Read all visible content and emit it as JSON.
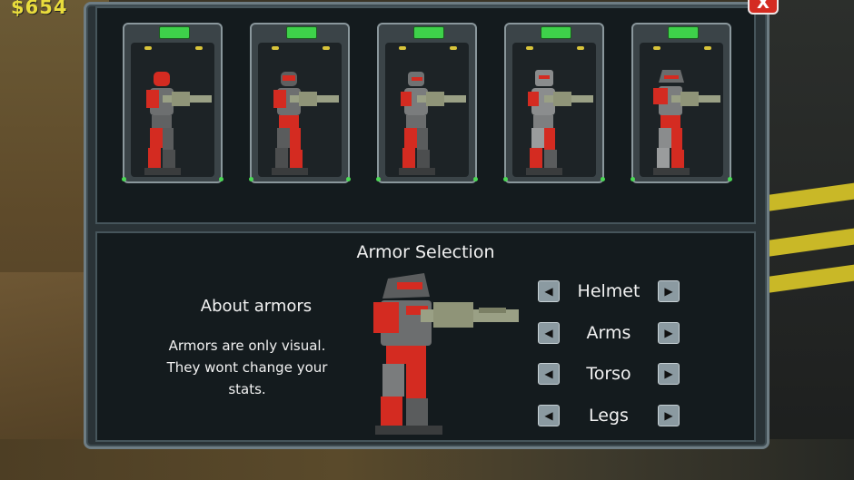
{
  "hud": {
    "money": "$654"
  },
  "dialog": {
    "close_label": "X",
    "cards": [
      {
        "id": "armor-1"
      },
      {
        "id": "armor-2"
      },
      {
        "id": "armor-3"
      },
      {
        "id": "armor-4"
      },
      {
        "id": "armor-5"
      }
    ],
    "title": "Armor Selection",
    "about_title": "About armors",
    "about_text_line1": "Armors are only visual.",
    "about_text_line2": "They wont change your",
    "about_text_line3": "stats.",
    "selectors": [
      {
        "label": "Helmet"
      },
      {
        "label": "Arms"
      },
      {
        "label": "Torso"
      },
      {
        "label": "Legs"
      }
    ],
    "arrow_left_glyph": "◀",
    "arrow_right_glyph": "▶"
  },
  "colors": {
    "accent_red": "#d42b21",
    "panel_border": "#6e7d84",
    "card_tag_green": "#3ed14a",
    "money_yellow": "#e9dc3c"
  }
}
